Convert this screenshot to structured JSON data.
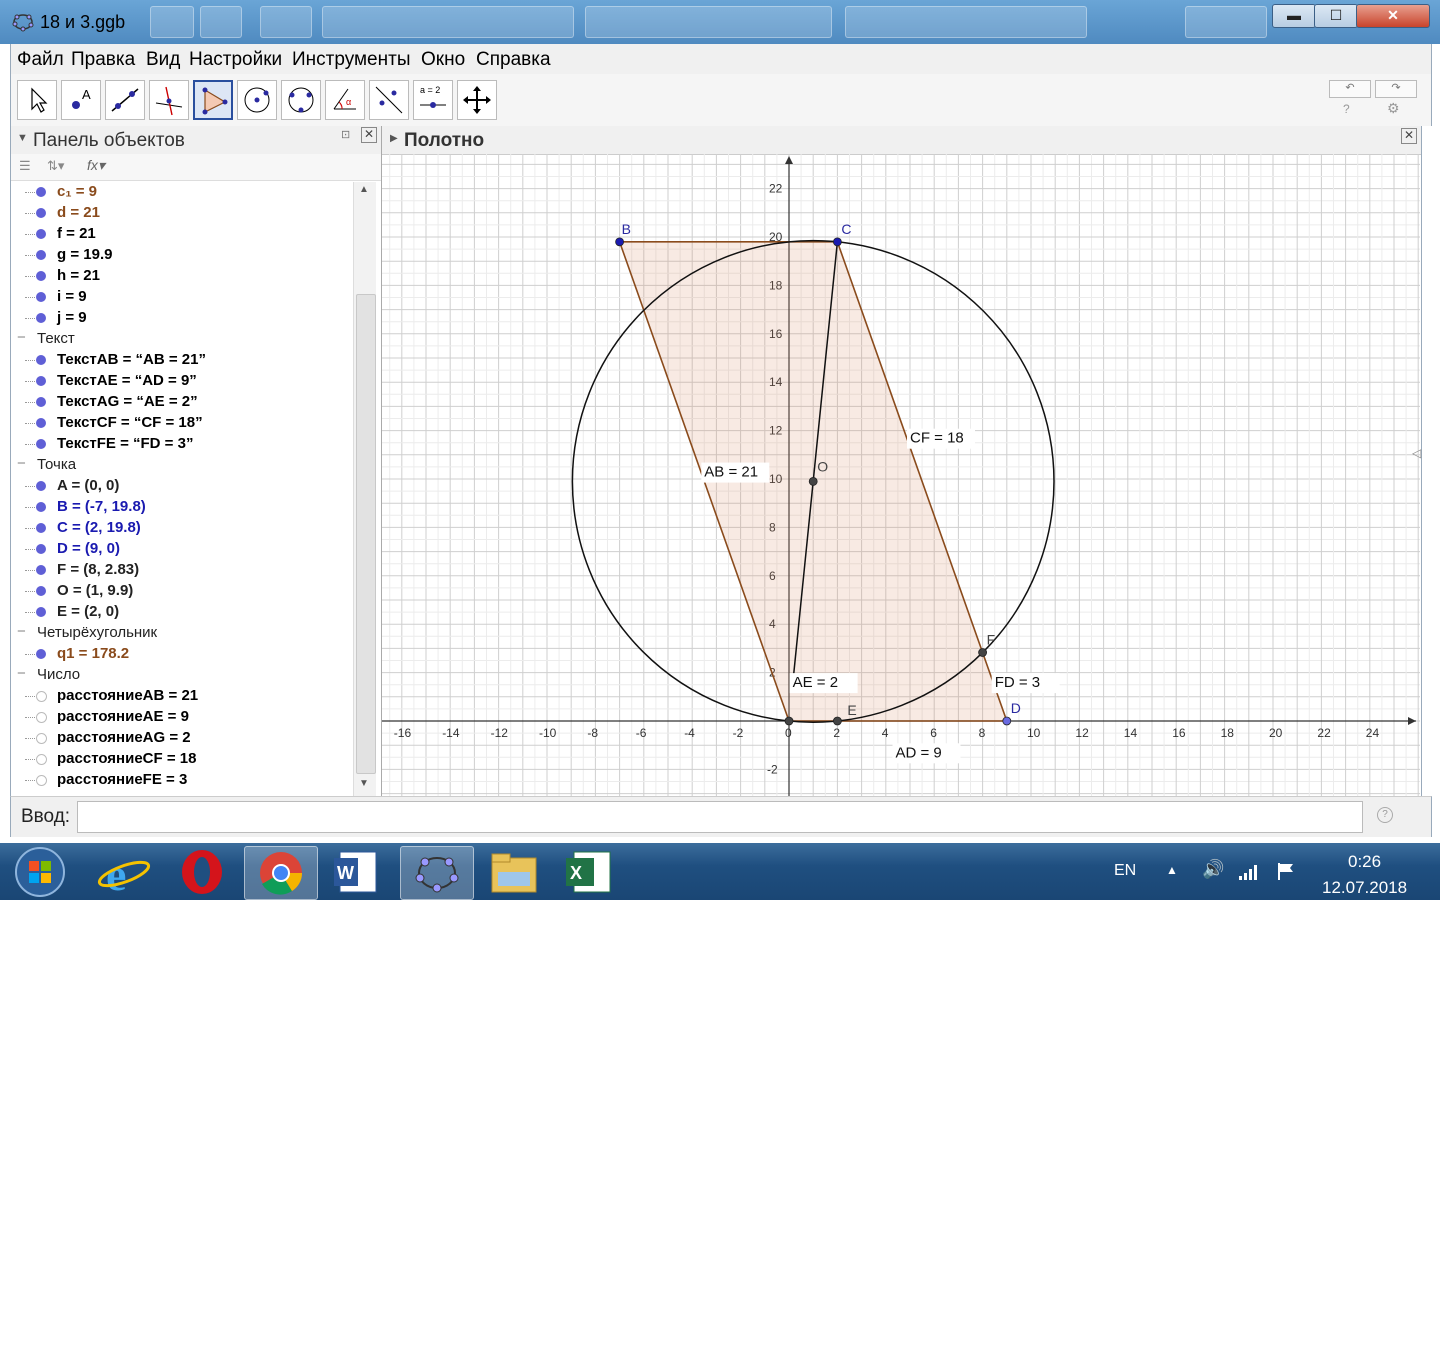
{
  "window": {
    "title": "18 и 3.ggb",
    "minimize": "▬",
    "maximize": "☐",
    "close": "✕"
  },
  "menu": [
    "Файл",
    "Правка",
    "Вид",
    "Настройки",
    "Инструменты",
    "Окно",
    "Справка"
  ],
  "toolbar": {
    "tools": [
      "move-tool",
      "point-tool",
      "line-tool",
      "perpendicular-tool",
      "polygon-tool",
      "circle-tool",
      "conic-tool",
      "angle-tool",
      "reflect-tool",
      "slider-tool",
      "move-view-tool"
    ],
    "slider_label": "a = 2"
  },
  "algebra": {
    "title": "Панель объектов",
    "number_rows": [
      {
        "text": "c₁ = 9",
        "color": "#8a4b1c"
      },
      {
        "text": "d = 21",
        "color": "#8a4b1c"
      },
      {
        "text": "f = 21",
        "color": "#000000"
      },
      {
        "text": "g = 19.9",
        "color": "#000000"
      },
      {
        "text": "h = 21",
        "color": "#000000"
      },
      {
        "text": "i = 9",
        "color": "#000000"
      },
      {
        "text": "j = 9",
        "color": "#000000"
      }
    ],
    "cat_text": "Текст",
    "text_rows": [
      {
        "text": "ТекстAB = “AB = 21”"
      },
      {
        "text": "ТекстAE = “AD = 9”"
      },
      {
        "text": "ТекстAG = “AE = 2”"
      },
      {
        "text": "ТекстCF = “CF = 18”"
      },
      {
        "text": "ТекстFE = “FD = 3”"
      }
    ],
    "cat_point": "Точка",
    "point_rows": [
      {
        "text": "A = (0, 0)",
        "color": "#222222"
      },
      {
        "text": "B = (-7, 19.8)",
        "color": "#1a1ab0"
      },
      {
        "text": "C = (2, 19.8)",
        "color": "#1a1ab0"
      },
      {
        "text": "D = (9, 0)",
        "color": "#1a1ab0"
      },
      {
        "text": "F = (8, 2.83)",
        "color": "#222222"
      },
      {
        "text": "O = (1, 9.9)",
        "color": "#222222"
      },
      {
        "text": "E = (2, 0)",
        "color": "#222222"
      }
    ],
    "cat_quad": "Четырёхугольник",
    "quad_rows": [
      {
        "text": "q1 = 178.2",
        "color": "#8a4b1c"
      }
    ],
    "cat_number": "Число",
    "dist_rows": [
      {
        "text": "расстояниеAB = 21"
      },
      {
        "text": "расстояниеAE = 9"
      },
      {
        "text": "расстояниеAG = 2"
      },
      {
        "text": "расстояниеCF = 18"
      },
      {
        "text": "расстояниеFE = 3"
      }
    ]
  },
  "graphics": {
    "title": "Полотно",
    "x_ticks": [
      -16,
      -14,
      -12,
      -10,
      -8,
      -6,
      -4,
      -2,
      0,
      2,
      4,
      6,
      8,
      10,
      12,
      14,
      16,
      18,
      20,
      22,
      24
    ],
    "y_ticks": [
      -2,
      2,
      4,
      6,
      8,
      10,
      12,
      14,
      16,
      18,
      20,
      22
    ],
    "points": [
      {
        "name": "A",
        "x": 0,
        "y": 0,
        "color": "#444444",
        "label": ""
      },
      {
        "name": "B",
        "x": -7,
        "y": 19.8,
        "color": "#1a1ab0",
        "label": "B"
      },
      {
        "name": "C",
        "x": 2,
        "y": 19.8,
        "color": "#1a1ab0",
        "label": "C"
      },
      {
        "name": "D",
        "x": 9,
        "y": 0,
        "color": "#6a6ae0",
        "label": "D"
      },
      {
        "name": "E",
        "x": 2,
        "y": 0,
        "color": "#444444",
        "label": "E"
      },
      {
        "name": "F",
        "x": 8,
        "y": 2.83,
        "color": "#444444",
        "label": "F"
      },
      {
        "name": "O",
        "x": 1,
        "y": 9.9,
        "color": "#444444",
        "label": "O"
      }
    ],
    "circle": {
      "cx": 1,
      "cy": 9.9,
      "r": 9.95
    },
    "labels": [
      {
        "text": "AB = 21",
        "x": -3.5,
        "y": 10.1
      },
      {
        "text": "CF = 18",
        "x": 5,
        "y": 22.9
      },
      {
        "text": "AE = 2",
        "x": 0.15,
        "y": 1.4
      },
      {
        "text": "FD = 3",
        "x": 8.5,
        "y": 1.4
      },
      {
        "text": "AD = 9",
        "x": 4.4,
        "y": -1.5
      }
    ],
    "cf_label": {
      "text": "CF = 18",
      "x": 5,
      "y": 11.5
    }
  },
  "input": {
    "label": "Ввод:",
    "value": ""
  },
  "taskbar": {
    "lang": "EN",
    "time": "0:26",
    "date": "12.07.2018"
  }
}
